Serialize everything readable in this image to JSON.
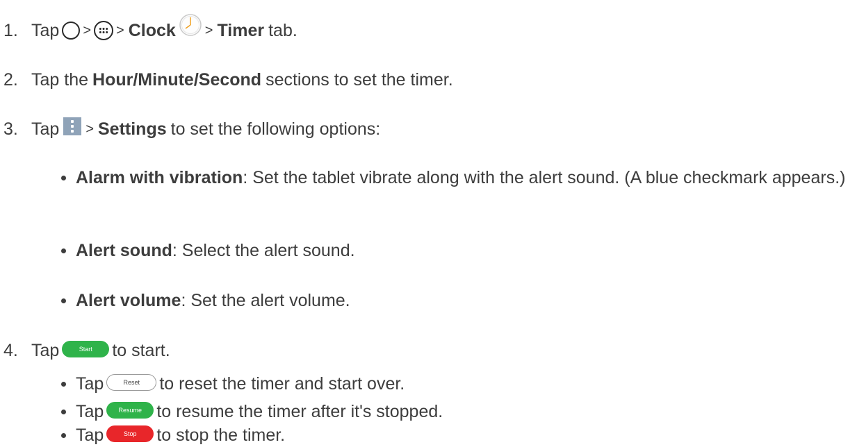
{
  "steps": [
    {
      "number": "1.",
      "parts": [
        "Tap",
        ">",
        ">",
        "Clock",
        ">",
        "Timer",
        "tab."
      ]
    },
    {
      "number": "2.",
      "parts": [
        "Tap the",
        "Hour/Minute/Second",
        "sections to set the timer."
      ]
    },
    {
      "number": "3.",
      "parts": [
        "Tap",
        ">",
        "Settings",
        "to set the following options:"
      ]
    },
    {
      "number": "4.",
      "parts": [
        "Tap",
        "to start."
      ]
    }
  ],
  "options": [
    {
      "term": "Alarm with vibration",
      "desc": ": Set the tablet vibrate along with the alert sound. (A blue checkmark appears.)"
    },
    {
      "term": "Alert sound",
      "desc": ": Select the alert sound."
    },
    {
      "term": "Alert volume",
      "desc": ": Set the alert volume."
    }
  ],
  "sub_steps": [
    {
      "prefix": "Tap",
      "button": "Reset",
      "text": "to reset the timer and start over."
    },
    {
      "prefix": "Tap",
      "button": "Resume",
      "text": "to resume the timer after it's stopped."
    },
    {
      "prefix": "Tap",
      "button": "Stop",
      "text": "to stop the timer."
    }
  ],
  "buttons": {
    "start": "Start"
  },
  "icons": {
    "home": "home-circle-icon",
    "apps": "apps-grid-icon",
    "clock": "clock-icon",
    "menu": "overflow-menu-icon"
  },
  "colors": {
    "start": "#2fb34a",
    "resume": "#2fb34a",
    "stop": "#e8262a",
    "menu_icon_bg": "#8fa3b8"
  }
}
